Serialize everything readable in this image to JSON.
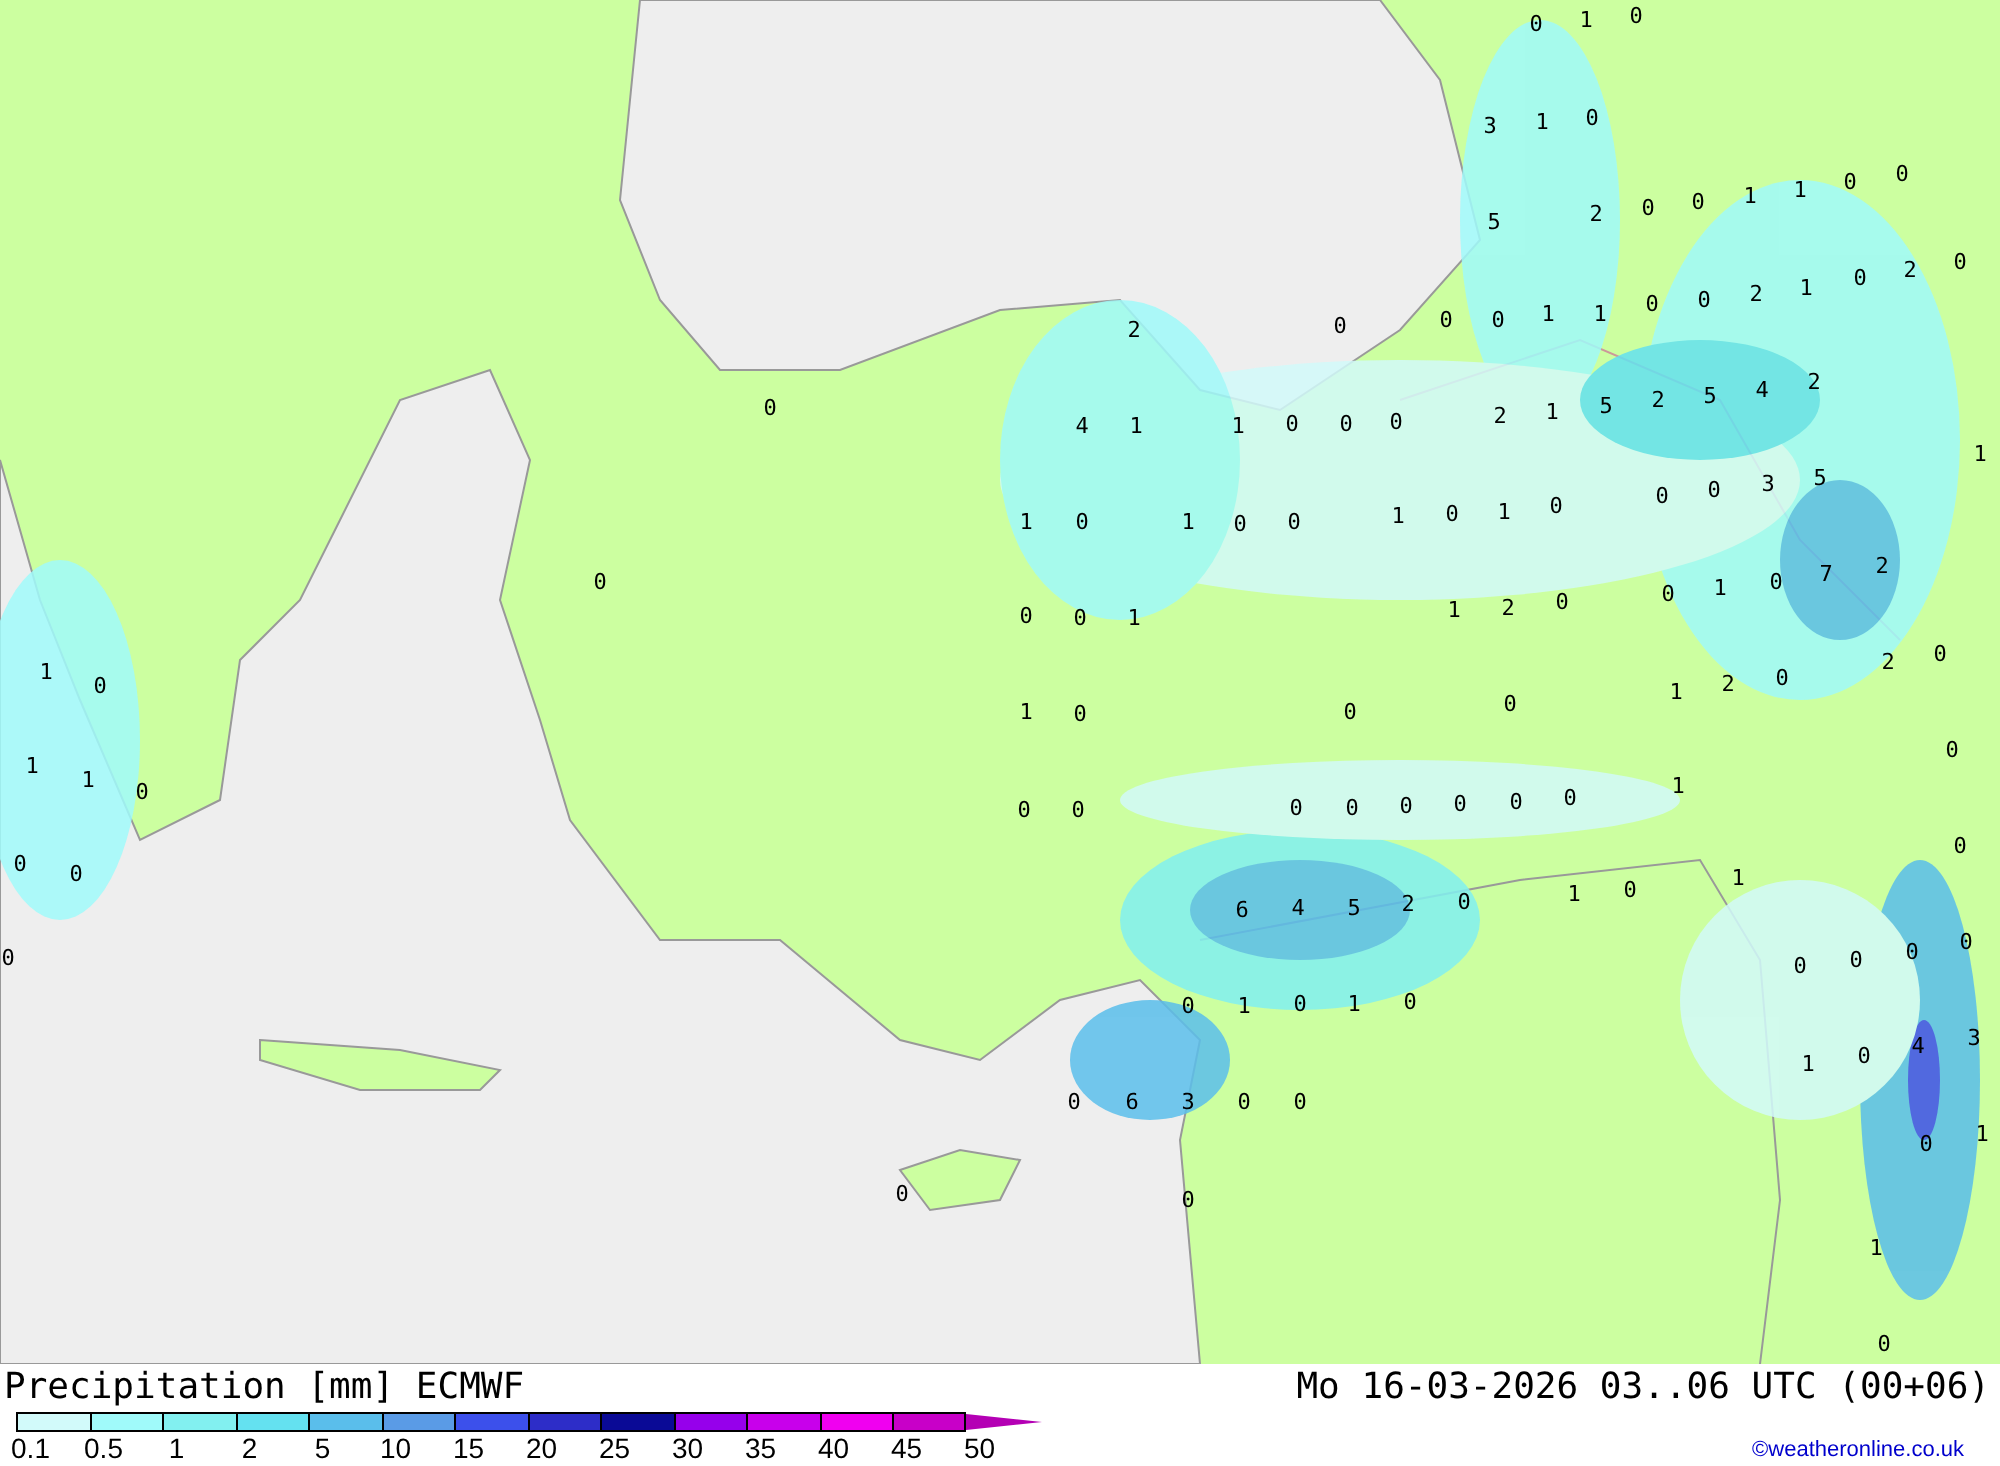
{
  "map": {
    "values": [
      "0",
      "1",
      "0",
      "3",
      "1",
      "0",
      "5",
      "2",
      "0",
      "0",
      "1",
      "1",
      "0",
      "0",
      "2",
      "0",
      "0",
      "0",
      "1",
      "1",
      "0",
      "0",
      "2",
      "1",
      "0",
      "2",
      "0",
      "0",
      "4",
      "1",
      "1",
      "0",
      "0",
      "0",
      "2",
      "1",
      "5",
      "2",
      "5",
      "4",
      "2",
      "1",
      "1",
      "0",
      "1",
      "0",
      "0",
      "1",
      "0",
      "1",
      "0",
      "0",
      "0",
      "3",
      "5",
      "0",
      "0",
      "0",
      "1",
      "1",
      "2",
      "0",
      "0",
      "1",
      "0",
      "7",
      "2",
      "1",
      "0",
      "1",
      "2",
      "0",
      "2",
      "0",
      "1",
      "0",
      "0",
      "0",
      "1",
      "1",
      "0",
      "0",
      "0",
      "0",
      "0",
      "0",
      "0",
      "0",
      "0",
      "0",
      "1",
      "0",
      "0",
      "1",
      "0",
      "1",
      "0",
      "6",
      "4",
      "5",
      "2",
      "0",
      "0",
      "0",
      "0",
      "0",
      "0",
      "0",
      "1",
      "0",
      "1",
      "0",
      "1",
      "0",
      "4",
      "3",
      "0",
      "6",
      "3",
      "0",
      "0",
      "0",
      "1",
      "0",
      "0",
      "1",
      "0"
    ]
  },
  "footer": {
    "title": "Precipitation [mm] ECMWF",
    "valid_time": "Mo 16-03-2026 03..06 UTC (00+06)",
    "credit": "©weatheronline.co.uk"
  },
  "legend": {
    "bins": [
      {
        "kind": "box",
        "color": "#d2fafa"
      },
      {
        "kind": "box",
        "color": "#a0fafa"
      },
      {
        "kind": "box",
        "color": "#82f0f0"
      },
      {
        "kind": "box",
        "color": "#64e1f0"
      },
      {
        "kind": "box",
        "color": "#5abeeb"
      },
      {
        "kind": "box",
        "color": "#5a9be6"
      },
      {
        "kind": "box",
        "color": "#3c50eb"
      },
      {
        "kind": "box",
        "color": "#2d2dc8"
      },
      {
        "kind": "box",
        "color": "#0a0a96"
      },
      {
        "kind": "box",
        "color": "#9600eb"
      },
      {
        "kind": "box",
        "color": "#c800eb"
      },
      {
        "kind": "box",
        "color": "#f000f0"
      },
      {
        "kind": "box",
        "color": "#c800c8"
      },
      {
        "kind": "arrow",
        "color": "#b400b4"
      }
    ],
    "ticks": [
      "0.1",
      "0.5",
      "1",
      "2",
      "5",
      "10",
      "15",
      "20",
      "25",
      "30",
      "35",
      "40",
      "45",
      "50"
    ]
  }
}
